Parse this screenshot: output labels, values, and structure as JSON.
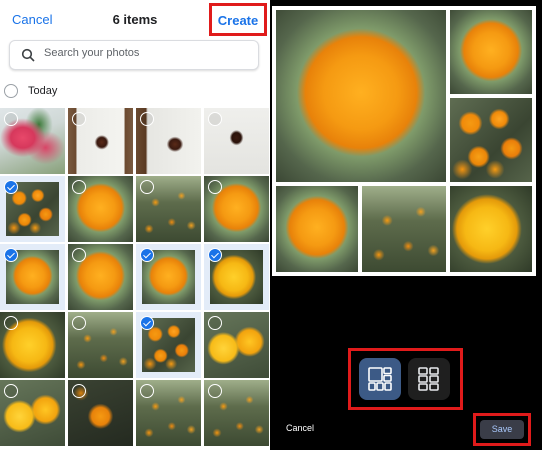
{
  "header": {
    "cancel_label": "Cancel",
    "selected_count": "6 items",
    "create_label": "Create"
  },
  "search": {
    "placeholder": "Search your photos"
  },
  "section": {
    "label": "Today"
  },
  "photos": [
    {
      "fill": "pink",
      "selected": false
    },
    {
      "fill": "wall-moth",
      "selected": false
    },
    {
      "fill": "wall-moth2",
      "selected": false
    },
    {
      "fill": "wall-moth3",
      "selected": false
    },
    {
      "fill": "multi",
      "selected": true
    },
    {
      "fill": "marigold",
      "selected": false
    },
    {
      "fill": "field",
      "selected": false
    },
    {
      "fill": "marigold",
      "selected": false
    },
    {
      "fill": "marigold",
      "selected": true
    },
    {
      "fill": "marigold",
      "selected": false
    },
    {
      "fill": "marigold",
      "selected": true
    },
    {
      "fill": "marigold2",
      "selected": true
    },
    {
      "fill": "marigold2",
      "selected": false
    },
    {
      "fill": "field",
      "selected": false
    },
    {
      "fill": "multi",
      "selected": true
    },
    {
      "fill": "two",
      "selected": false
    },
    {
      "fill": "two",
      "selected": false
    },
    {
      "fill": "dark",
      "selected": false
    },
    {
      "fill": "field",
      "selected": false
    },
    {
      "fill": "field",
      "selected": false
    }
  ],
  "collage": {
    "tiles": [
      {
        "fill": "marigold"
      },
      {
        "fill": "marigold"
      },
      {
        "fill": "multi"
      },
      {
        "fill": "marigold"
      },
      {
        "fill": "field"
      },
      {
        "fill": "marigold2"
      }
    ]
  },
  "layout_options": [
    {
      "icon": "layout-collage-icon",
      "active": true
    },
    {
      "icon": "layout-grid-icon",
      "active": false
    }
  ],
  "footer": {
    "cancel_label": "Cancel",
    "save_label": "Save"
  },
  "colors": {
    "accent": "#1a73e8",
    "highlight_box": "#e01b1b",
    "active_layout": "#3c5a86"
  }
}
